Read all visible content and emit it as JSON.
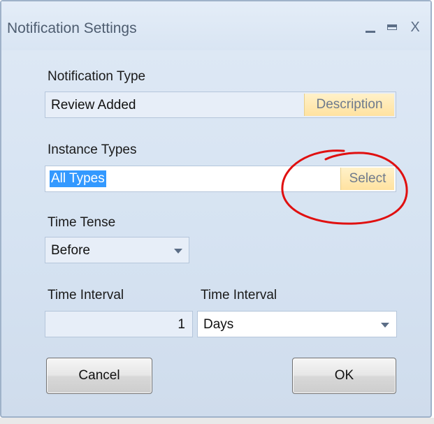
{
  "window": {
    "title": "Notification Settings",
    "minimize_icon": "minimize-icon",
    "maximize_icon": "maximize-icon",
    "close_symbol": "X"
  },
  "notification_type": {
    "label": "Notification Type",
    "value": "Review Added",
    "button_label": "Description"
  },
  "instance_types": {
    "label": "Instance Types",
    "value": "All Types",
    "button_label": "Select"
  },
  "time_tense": {
    "label": "Time Tense",
    "selected": "Before"
  },
  "time_interval_value": {
    "label": "Time Interval",
    "value": "1"
  },
  "time_interval_unit": {
    "label": "Time Interval",
    "selected": "Days"
  },
  "buttons": {
    "cancel_label": "Cancel",
    "ok_label": "OK"
  },
  "colors": {
    "accent_button": "#ffe2a0",
    "selection": "#3399ff",
    "annotation": "#e01010"
  }
}
